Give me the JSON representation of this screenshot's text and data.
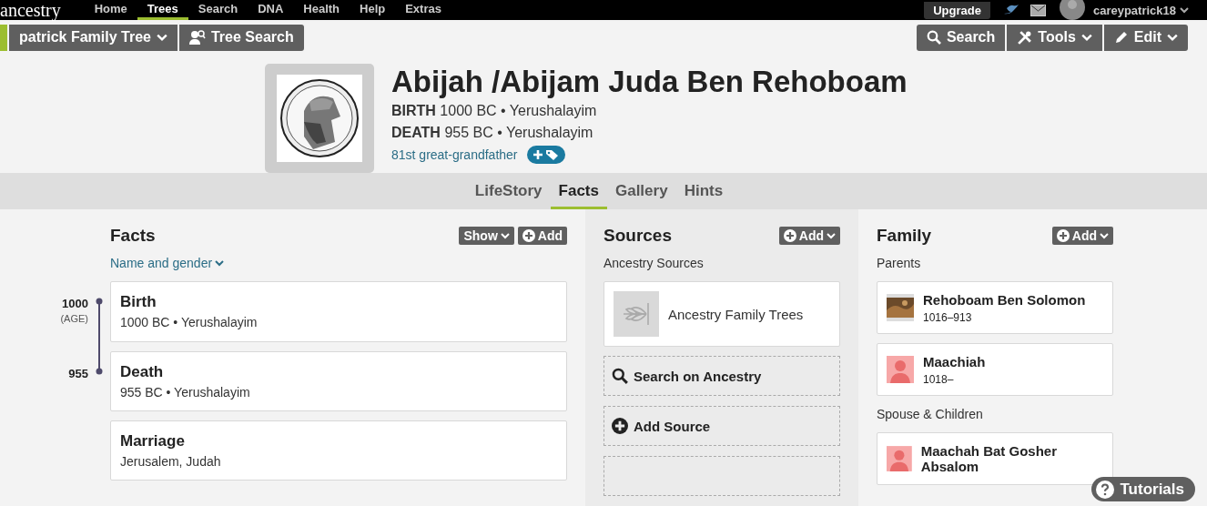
{
  "nav": {
    "logo": "ancestry",
    "items": [
      {
        "label": "Home",
        "selected": false
      },
      {
        "label": "Trees",
        "selected": true
      },
      {
        "label": "Search",
        "selected": false
      },
      {
        "label": "DNA",
        "selected": false
      },
      {
        "label": "Health",
        "selected": false
      },
      {
        "label": "Help",
        "selected": false
      },
      {
        "label": "Extras",
        "selected": false
      }
    ],
    "upgrade": "Upgrade",
    "username": "careypatrick18"
  },
  "toolbar": {
    "tree": "patrick Family Tree",
    "tree_search": "Tree Search",
    "actions": [
      {
        "label": "Search",
        "kind": "search",
        "dropdown": false
      },
      {
        "label": "Tools",
        "kind": "tools",
        "dropdown": true
      },
      {
        "label": "Edit",
        "kind": "edit",
        "dropdown": true
      }
    ]
  },
  "person": {
    "name": "Abijah /Abijam Juda Ben Rehoboam",
    "events": [
      {
        "label": "BIRTH",
        "value": "1000 BC • Yerushalayim"
      },
      {
        "label": "DEATH",
        "value": "955 BC • Yerushalayim"
      }
    ],
    "relation": "81st great-grandfather"
  },
  "tabs": [
    {
      "label": "LifeStory",
      "selected": false
    },
    {
      "label": "Facts",
      "selected": true
    },
    {
      "label": "Gallery",
      "selected": false
    },
    {
      "label": "Hints",
      "selected": false
    }
  ],
  "facts": {
    "title": "Facts",
    "buttons": [
      {
        "label": "Show",
        "kind": "dropdown"
      },
      {
        "label": "Add",
        "kind": "add"
      }
    ],
    "filter": "Name and gender",
    "items": [
      {
        "title": "Birth",
        "detail": "1000 BC • Yerushalayim",
        "year": "1000",
        "note": "(AGE)"
      },
      {
        "title": "Death",
        "detail": "955 BC • Yerushalayim",
        "year": "955"
      },
      {
        "title": "Marriage",
        "detail": "Jerusalem, Judah"
      }
    ]
  },
  "sources": {
    "title": "Sources",
    "add": "Add",
    "subtitle": "Ancestry Sources",
    "items": [
      {
        "label": "Ancestry Family Trees"
      }
    ],
    "actions": [
      {
        "label": "Search on Ancestry",
        "kind": "search"
      },
      {
        "label": "Add Source",
        "kind": "add"
      },
      {
        "kind": "cut"
      }
    ]
  },
  "family": {
    "title": "Family",
    "add": "Add",
    "groups": [
      {
        "label": "Parents",
        "members": [
          {
            "name": "Rehoboam Ben Solomon",
            "years": "1016–913"
          },
          {
            "name": "Maachiah",
            "years": "1018–",
            "kind": "female"
          }
        ]
      },
      {
        "label": "Spouse & Children",
        "members": [
          {
            "name": "Maachah Bat Gosher Absalom",
            "kind": "female"
          }
        ]
      }
    ]
  },
  "tutorials": "Tutorials"
}
